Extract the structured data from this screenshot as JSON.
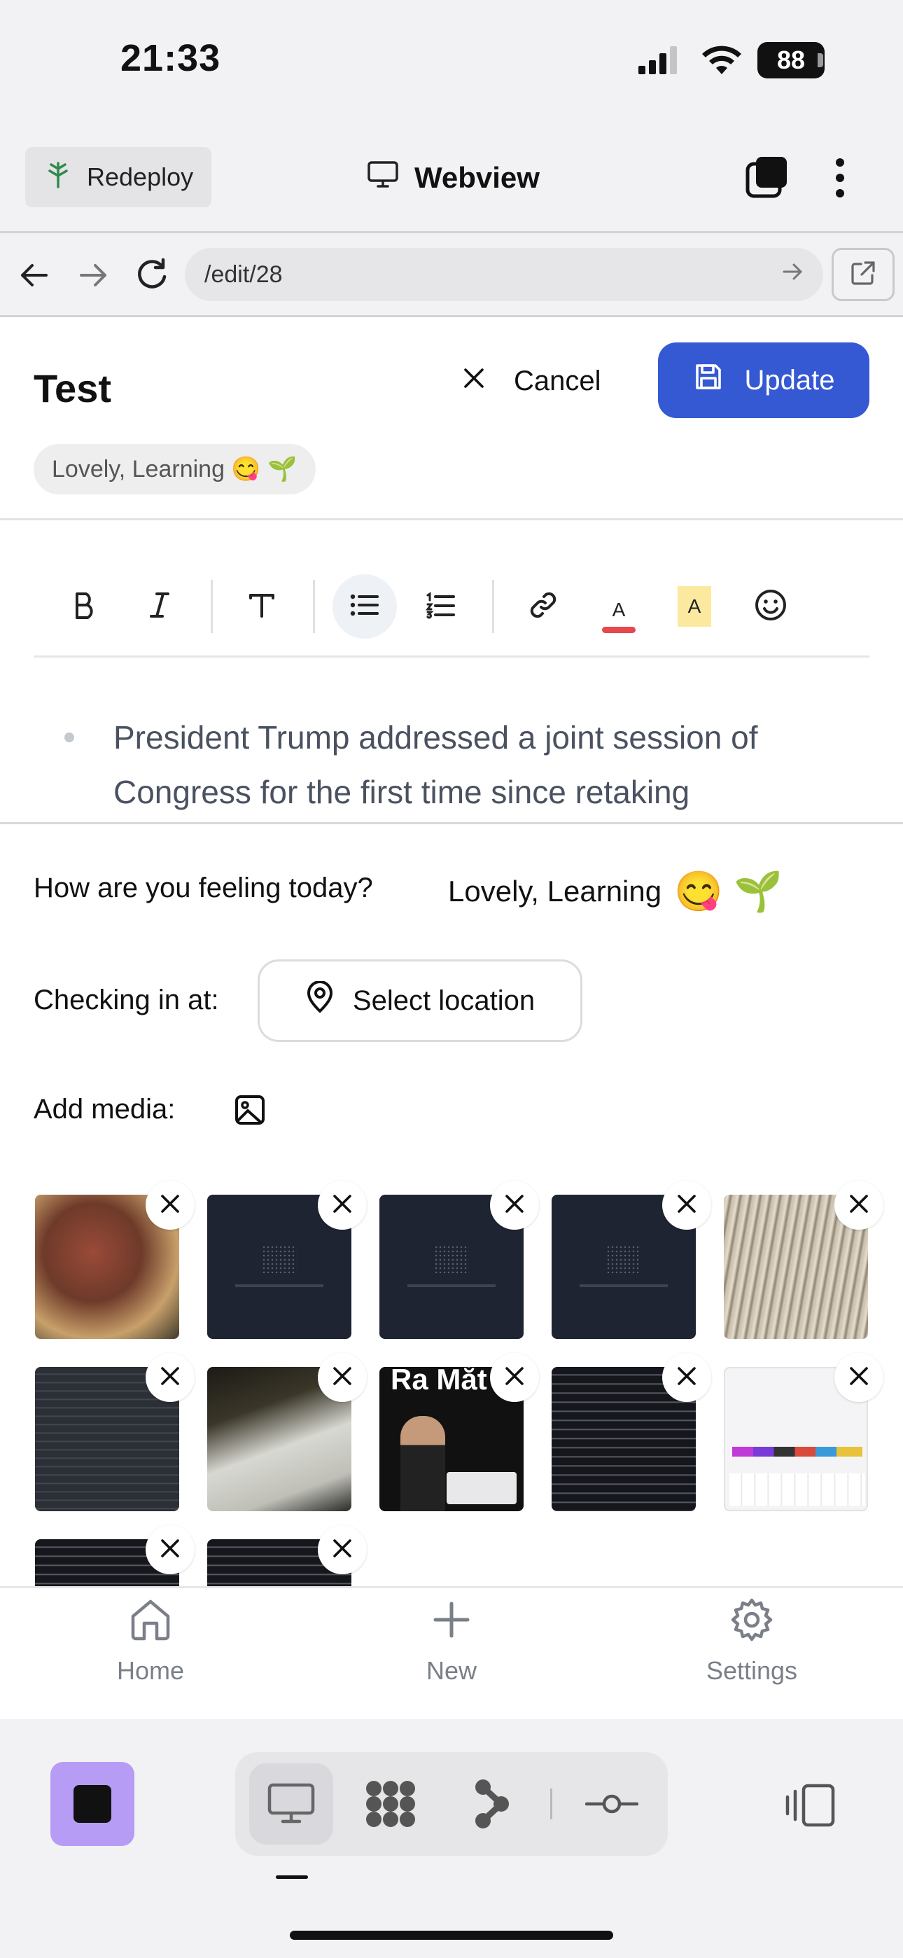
{
  "status_bar": {
    "time": "21:33",
    "battery": "88"
  },
  "header": {
    "redeploy_label": "Redeploy",
    "title": "Webview"
  },
  "address_bar": {
    "url": "/edit/28"
  },
  "entry": {
    "title": "Test",
    "cancel_label": "Cancel",
    "update_label": "Update",
    "mood_chip": "Lovely, Learning 😋 🌱"
  },
  "toolbar": {
    "items": [
      "bold",
      "italic",
      "text-style",
      "bullet-list",
      "numbered-list",
      "link",
      "text-color",
      "highlight",
      "emoji"
    ],
    "text_color": "#e5484d",
    "highlight_color": "#fbe9a0",
    "active": "bullet-list"
  },
  "editor": {
    "text": "President Trump addressed a joint session of Congress for the first time since retaking"
  },
  "form": {
    "mood_label": "How are you feeling today?",
    "mood_value": "Lovely, Learning",
    "mood_emojis": "😋 🌱",
    "location_label": "Checking in at:",
    "location_button": "Select location",
    "media_label": "Add media:"
  },
  "media": {
    "count": 12,
    "items": [
      "steak-photo",
      "dark-app-screenshot",
      "dark-app-screenshot",
      "dark-app-screenshot",
      "network-cables-photo",
      "terminal-screenshot",
      "monitor-photo",
      "ra-mat-poster",
      "terminal-screenshot",
      "keyboard-screenshot",
      "terminal-screenshot",
      "terminal-screenshot"
    ],
    "poster_text": "Ra Mắt"
  },
  "bottom_nav": {
    "home": "Home",
    "new": "New",
    "settings": "Settings"
  },
  "colors": {
    "accent": "#3559d3",
    "dock_accent": "#b69cf5"
  }
}
